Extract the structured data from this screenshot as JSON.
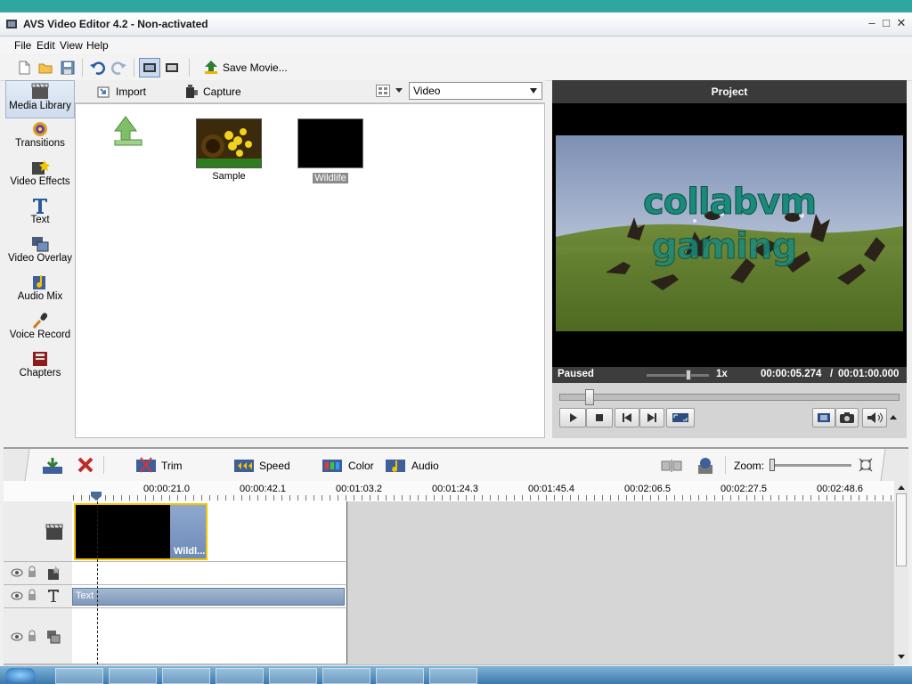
{
  "window": {
    "title": "AVS Video Editor 4.2 - Non-activated"
  },
  "menu": [
    "File",
    "Edit",
    "View",
    "Help"
  ],
  "toolbar": {
    "save_movie_label": "Save Movie..."
  },
  "sidebar": {
    "items": [
      {
        "label": "Media Library",
        "icon": "media-library-icon"
      },
      {
        "label": "Transitions",
        "icon": "transitions-icon"
      },
      {
        "label": "Video Effects",
        "icon": "video-effects-icon"
      },
      {
        "label": "Text",
        "icon": "text-icon"
      },
      {
        "label": "Video Overlay",
        "icon": "video-overlay-icon"
      },
      {
        "label": "Audio Mix",
        "icon": "audio-mix-icon"
      },
      {
        "label": "Voice Record",
        "icon": "voice-record-icon"
      },
      {
        "label": "Chapters",
        "icon": "chapters-icon"
      }
    ]
  },
  "library": {
    "import_label": "Import",
    "capture_label": "Capture",
    "filter_value": "Video",
    "items": [
      {
        "label": "Sample"
      },
      {
        "label": "Wildlife",
        "selected": true
      }
    ]
  },
  "preview": {
    "header": "Project",
    "overlay_line1": "collabvm",
    "overlay_line2": "gaming",
    "status": "Paused",
    "speed": "1x",
    "current_time": "00:00:05.274",
    "separator": "/",
    "total_time": "00:01:00.000"
  },
  "timeline": {
    "tools": {
      "trim": "Trim",
      "speed": "Speed",
      "color": "Color",
      "audio": "Audio",
      "zoom": "Zoom:"
    },
    "ruler": [
      "00:00:21.0",
      "00:00:42.1",
      "00:01:03.2",
      "00:01:24.3",
      "00:01:45.4",
      "00:02:06.5",
      "00:02:27.5",
      "00:02:48.6"
    ],
    "clip_label": "Wildl...",
    "text_clip_label": "Text"
  },
  "colors": {
    "accent": "#f2c400",
    "text_overlay": "#1a8a7a",
    "header_dark": "#3a3a3a"
  }
}
